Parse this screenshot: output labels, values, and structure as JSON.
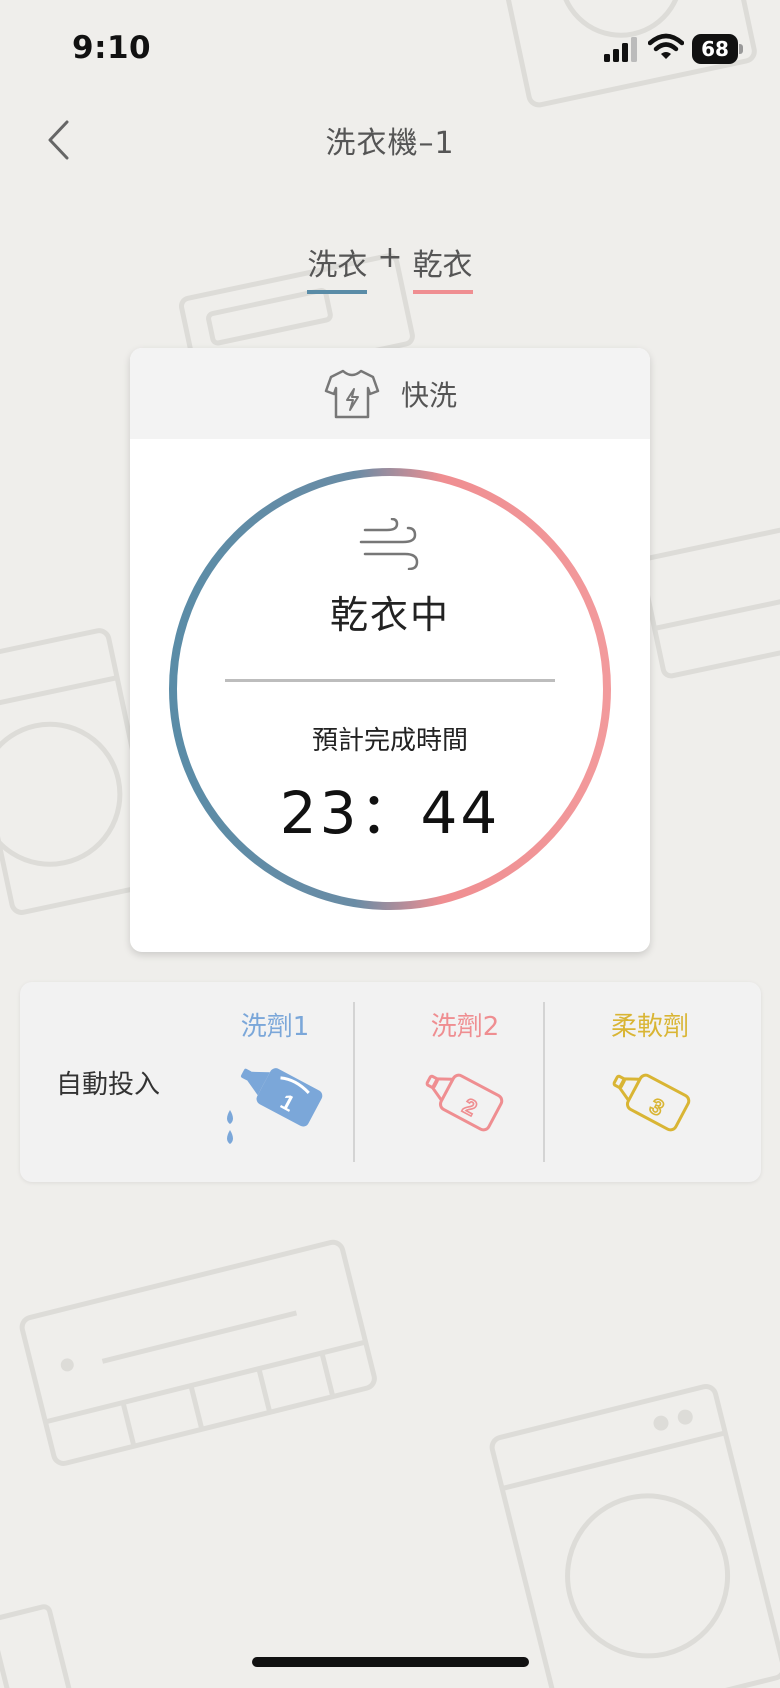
{
  "status_bar": {
    "time": "9:10",
    "battery": "68"
  },
  "nav": {
    "title": "洗衣機–1"
  },
  "mode": {
    "wash": "洗衣",
    "plus": "+",
    "dry": "乾衣"
  },
  "program": {
    "label": "快洗"
  },
  "cycle": {
    "status": "乾衣中",
    "eta_label": "預計完成時間",
    "eta_time": "23：44"
  },
  "auto_dose": {
    "label": "自動投入",
    "items": [
      {
        "label": "洗劑1",
        "number": "1",
        "color": "#7ba7d9",
        "active": true
      },
      {
        "label": "洗劑2",
        "number": "2",
        "color": "#ef8e91",
        "active": false
      },
      {
        "label": "柔軟劑",
        "number": "3",
        "color": "#d9b534",
        "active": false
      }
    ]
  },
  "colors": {
    "wash_accent": "#5a8ca7",
    "dry_accent": "#ef8e91",
    "background": "#efeeeb"
  }
}
